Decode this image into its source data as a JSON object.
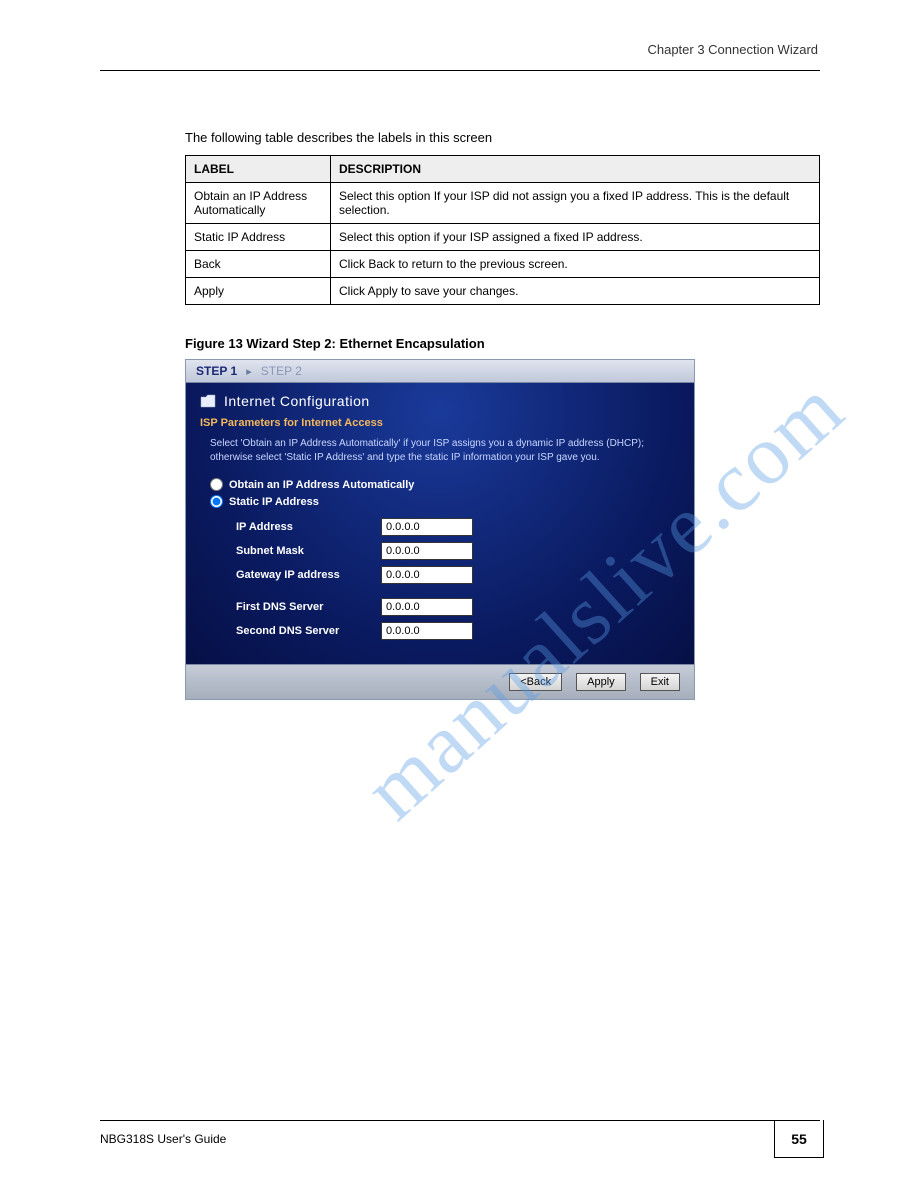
{
  "headerRight": "Chapter 3 Connection Wizard",
  "tableIntro": "The following table describes the labels in this screen",
  "table": {
    "headers": [
      "LABEL",
      "DESCRIPTION"
    ],
    "rows": [
      [
        "Obtain an IP Address Automatically",
        "Select this option If your ISP did not assign you a fixed IP address. This is the default selection."
      ],
      [
        "Static IP Address",
        "Select this option if your ISP assigned a fixed IP address."
      ],
      [
        "Back",
        "Click Back to return to the previous screen."
      ],
      [
        "Apply",
        "Click Apply to save your changes."
      ]
    ]
  },
  "figureCaption": "Figure 13   Wizard Step 2: Ethernet Encapsulation",
  "app": {
    "step1": "STEP 1",
    "step2": "STEP 2",
    "panelTitle": "Internet Configuration",
    "sectionLabel": "ISP Parameters for Internet Access",
    "desc": "Select 'Obtain an IP Address Automatically' if your ISP assigns you a dynamic IP address (DHCP); otherwise select 'Static IP Address' and type the static IP information your ISP gave you.",
    "radioAuto": "Obtain an IP Address Automatically",
    "radioStatic": "Static IP Address",
    "fields": {
      "ip": {
        "label": "IP Address",
        "value": "0.0.0.0"
      },
      "mask": {
        "label": "Subnet Mask",
        "value": "0.0.0.0"
      },
      "gw": {
        "label": "Gateway IP address",
        "value": "0.0.0.0"
      },
      "dns1": {
        "label": "First DNS Server",
        "value": "0.0.0.0"
      },
      "dns2": {
        "label": "Second DNS Server",
        "value": "0.0.0.0"
      }
    },
    "buttons": {
      "back": "<Back",
      "apply": "Apply",
      "exit": "Exit"
    }
  },
  "watermark": "manualslive.com",
  "footerLeft": "NBG318S User's Guide",
  "pageNumber": "55"
}
